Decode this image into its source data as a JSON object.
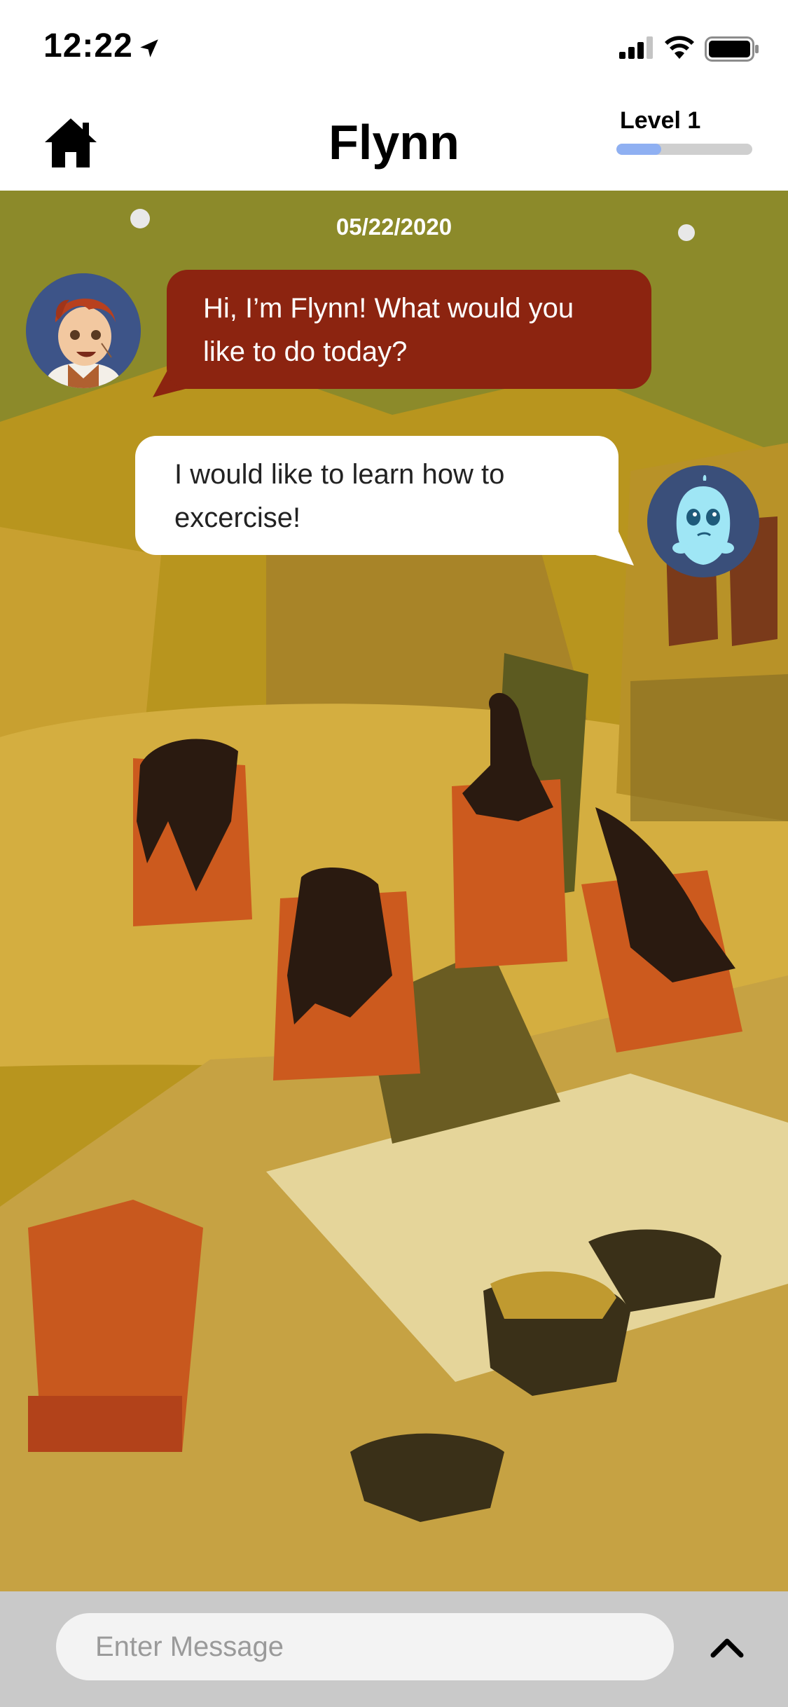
{
  "status_bar": {
    "time": "12:22",
    "icons": [
      "location-arrow-icon",
      "signal-bars-icon",
      "wifi-icon",
      "battery-icon"
    ]
  },
  "nav": {
    "home_icon": "home-icon",
    "title": "Flynn",
    "level_label": "Level 1",
    "level_progress": 0.33,
    "level_progress_color": "#8fb0f2"
  },
  "chat": {
    "date": "05/22/2020",
    "messages": [
      {
        "sender": "bot",
        "avatar": "flynn-avatar",
        "text": "Hi, I’m Flynn! What would you like to do today?",
        "bubble_color": "#8c2410"
      },
      {
        "sender": "user",
        "avatar": "blue-creature-avatar",
        "text": "I would like to learn how to excercise!",
        "bubble_color": "#ffffff"
      }
    ],
    "background": "yoga-class-illustration"
  },
  "composer": {
    "placeholder": "Enter Message",
    "expand_icon": "chevron-up-icon"
  }
}
